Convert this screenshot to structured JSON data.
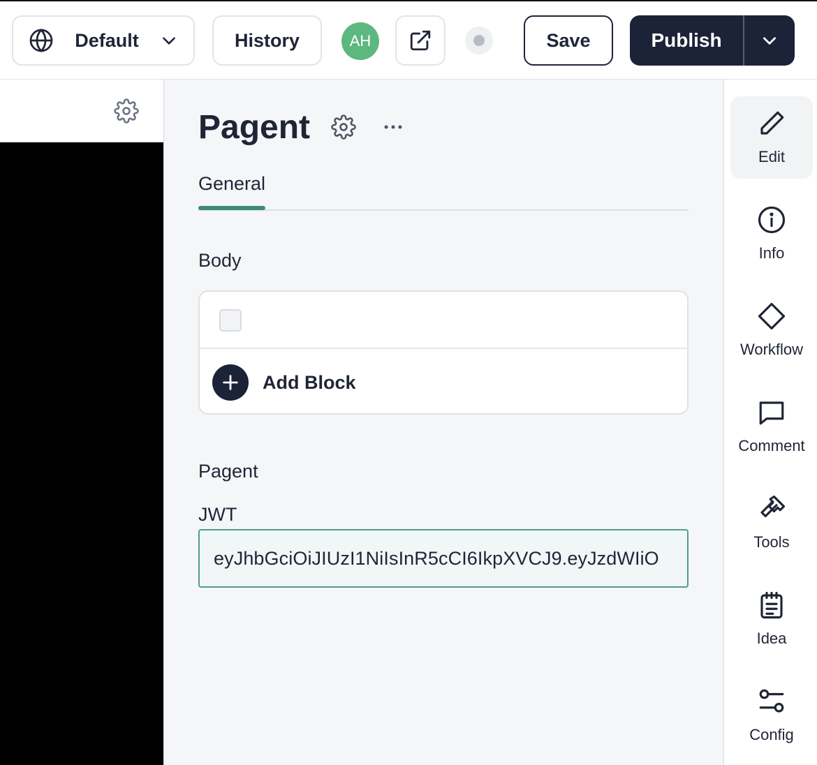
{
  "topbar": {
    "locale_label": "Default",
    "history_label": "History",
    "avatar_initials": "AH",
    "save_label": "Save",
    "publish_label": "Publish"
  },
  "page": {
    "title": "Pagent"
  },
  "tabs": [
    {
      "label": "General",
      "active": true
    }
  ],
  "body_section": {
    "label": "Body",
    "add_block_label": "Add Block"
  },
  "pagent_section": {
    "label": "Pagent",
    "jwt_label": "JWT",
    "jwt_value": "eyJhbGciOiJIUzI1NiIsInR5cCI6IkpXVCJ9.eyJzdWIiO"
  },
  "rail": [
    {
      "label": "Edit",
      "icon": "pencil-icon",
      "active": true
    },
    {
      "label": "Info",
      "icon": "info-icon",
      "active": false
    },
    {
      "label": "Workflow",
      "icon": "diamond-icon",
      "active": false
    },
    {
      "label": "Comment",
      "icon": "comment-icon",
      "active": false
    },
    {
      "label": "Tools",
      "icon": "hammer-icon",
      "active": false
    },
    {
      "label": "Idea",
      "icon": "clipboard-icon",
      "active": false
    },
    {
      "label": "Config",
      "icon": "sliders-icon",
      "active": false
    }
  ],
  "colors": {
    "primary_dark": "#1c2238",
    "accent_teal": "#3d8a78",
    "avatar_green": "#5db87f"
  }
}
